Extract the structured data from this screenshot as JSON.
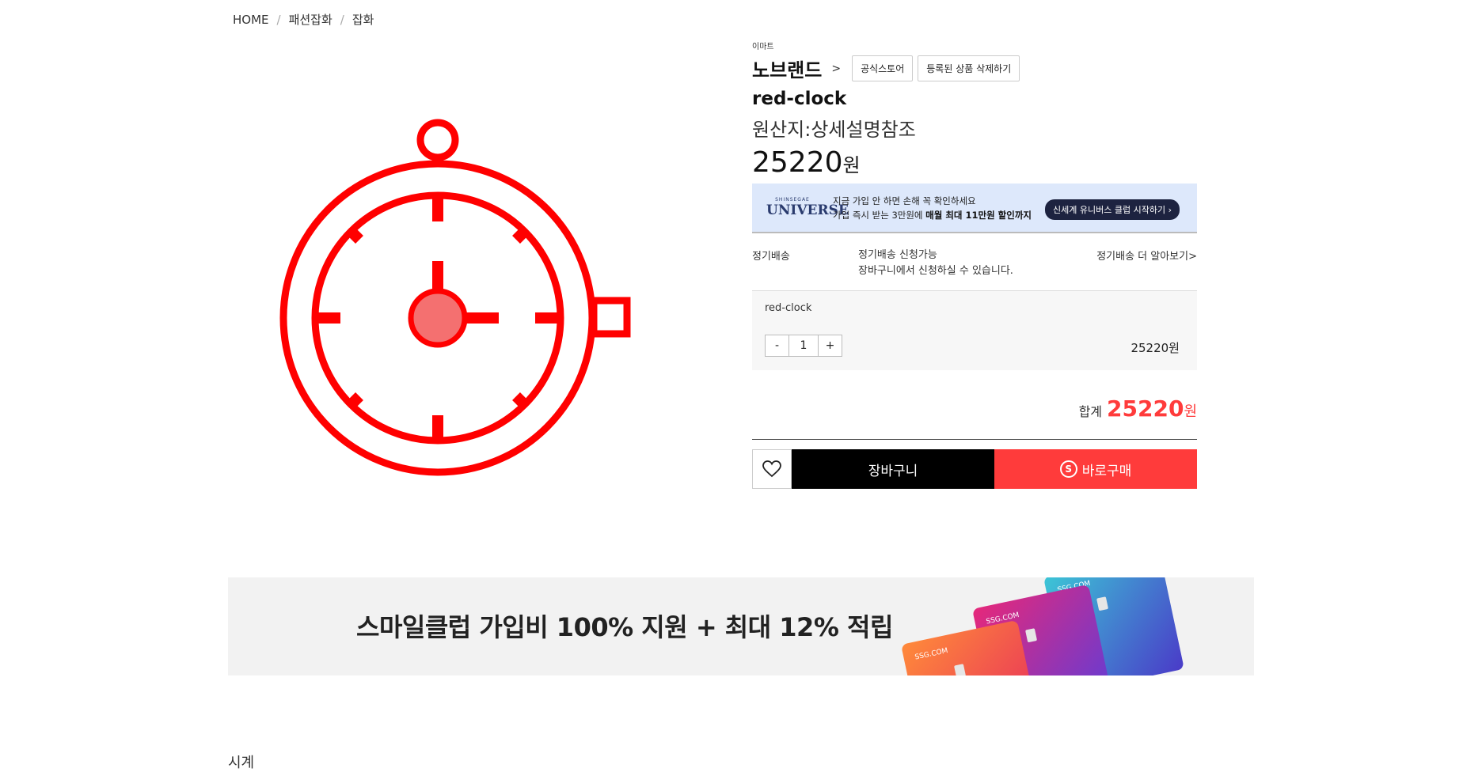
{
  "breadcrumb": {
    "home": "HOME",
    "sep": "/",
    "cat1": "패션잡화",
    "cat2": "잡화"
  },
  "product": {
    "seller": "이마트",
    "brand": "노브랜드",
    "brand_arrow": ">",
    "official_store": "공식스토어",
    "delete_registered": "등록된 상품 삭제하기",
    "name": "red-clock",
    "origin": "원산지:상세설명참조",
    "price": "25220",
    "price_unit": "원",
    "image_icon": "stopwatch-icon",
    "image_color": "#ff0000"
  },
  "universe_banner": {
    "logo_top": "SHINSEGAE",
    "logo_main": "UNIVERSE",
    "line1": "지금 가입 안 하면 손해 꼭 확인하세요",
    "line2_pre": "가입 즉시 받는 3만원에 ",
    "line2_bold": "매월 최대 11만원 할인까지",
    "cta": "신세계 유니버스 클럽 시작하기 ›"
  },
  "subscription": {
    "label": "정기배송",
    "line1": "정기배송 신청가능",
    "line2": "장바구니에서 신청하실 수 있습니다.",
    "more": "정기배송 더 알아보기>"
  },
  "option": {
    "name": "red-clock",
    "minus": "-",
    "qty": "1",
    "plus": "+",
    "price": "25220원"
  },
  "total": {
    "label": "합계",
    "amount": "25220",
    "unit": "원"
  },
  "actions": {
    "cart": "장바구니",
    "buy": "바로구매",
    "buy_icon": "S"
  },
  "promo": {
    "text": "스마일클럽 가입비 100% 지원 + 최대 12% 적립",
    "card_label": "SSG.COM"
  },
  "section": {
    "title": "시계"
  },
  "colors": {
    "accent": "#ff3b3b",
    "banner_bg": "#dde8fb",
    "cart_bg": "#000000"
  }
}
